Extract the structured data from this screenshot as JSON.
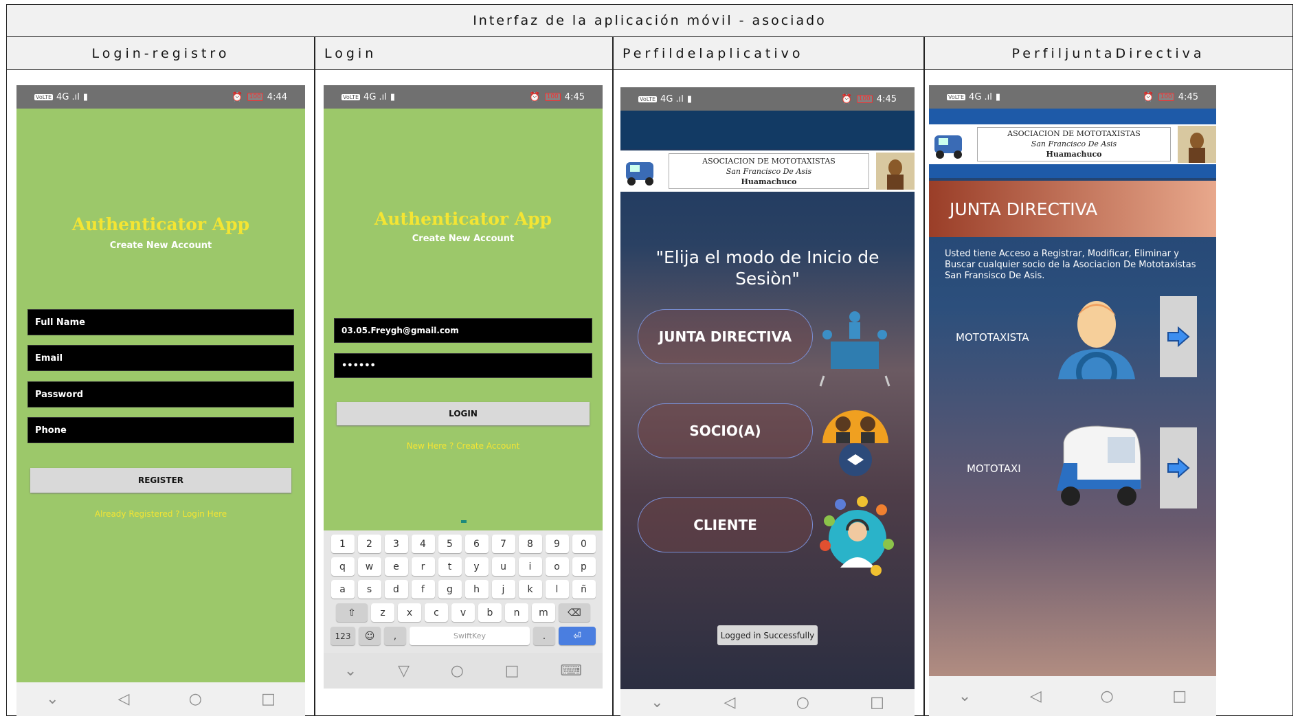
{
  "table": {
    "title": "Interfaz de la aplicación móvil - asociado",
    "columns": [
      "Login-registro",
      "Login",
      "Perfildelaplicativo",
      "PerfiljuntaDirectiva"
    ]
  },
  "status_bar": {
    "carrier_chip": "VoLTE",
    "signal": "4G .ıl",
    "battery": "100",
    "time_1": "4:44",
    "time_2": "4:45",
    "time_3": "4:45",
    "time_4": "4:45"
  },
  "register_screen": {
    "app_title": "Authenticator App",
    "subtitle": "Create New Account",
    "fields": {
      "full_name": "Full Name",
      "email": "Email",
      "password": "Password",
      "phone": "Phone"
    },
    "register_button": "REGISTER",
    "login_link": "Already Registered ? Login Here"
  },
  "login_screen": {
    "app_title": "Authenticator App",
    "subtitle": "Create New Account",
    "email_value": "03.05.Freygh@gmail.com",
    "password_value": "••••••",
    "login_button": "LOGIN",
    "create_link": "New Here ? Create Account",
    "keyboard": {
      "row1": [
        "1",
        "2",
        "3",
        "4",
        "5",
        "6",
        "7",
        "8",
        "9",
        "0"
      ],
      "row2": [
        "q",
        "w",
        "e",
        "r",
        "t",
        "y",
        "u",
        "i",
        "o",
        "p"
      ],
      "row3": [
        "a",
        "s",
        "d",
        "f",
        "g",
        "h",
        "j",
        "k",
        "l",
        "ñ"
      ],
      "row4": [
        "z",
        "x",
        "c",
        "v",
        "b",
        "n",
        "m"
      ],
      "num_key": "123",
      "space_label": "SwiftKey"
    }
  },
  "profile_screen": {
    "banner_line1": "ASOCIACION DE MOTOTAXISTAS",
    "banner_line2": "San Francisco De Asis",
    "banner_line3": "Huamachuco",
    "heading": "\"Elija el modo de Inicio de Sesiòn\"",
    "btn_junta": "JUNTA DIRECTIVA",
    "btn_socio": "SOCIO(A)",
    "btn_cliente": "CLIENTE",
    "toast": "Logged in Successfully"
  },
  "board_screen": {
    "banner_line1": "ASOCIACION DE MOTOTAXISTAS",
    "banner_line2": "San Francisco De Asis",
    "banner_line3": "Huamachuco",
    "header": "JUNTA DIRECTIVA",
    "description": "Usted tiene Acceso a Registrar, Modificar, Eliminar y Buscar cualquier socio de la Asociacion De Mototaxistas San Fransisco De Asis.",
    "item1": "MOTOTAXISTA",
    "item2": "MOTOTAXI"
  }
}
